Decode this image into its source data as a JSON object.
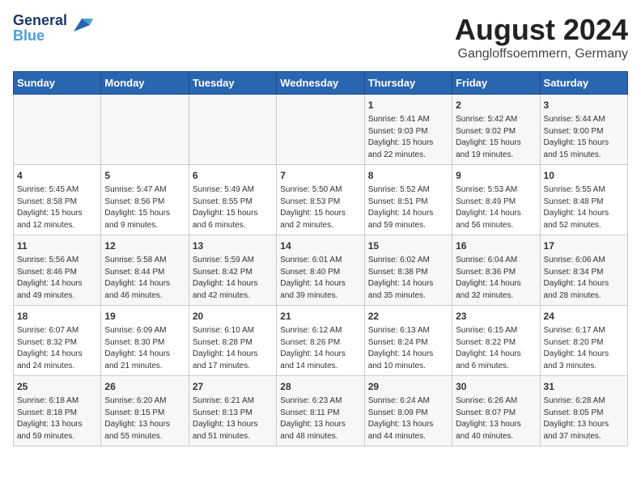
{
  "header": {
    "logo_line1": "General",
    "logo_line2": "Blue",
    "main_title": "August 2024",
    "subtitle": "Gangloffsoemmern, Germany"
  },
  "days_of_week": [
    "Sunday",
    "Monday",
    "Tuesday",
    "Wednesday",
    "Thursday",
    "Friday",
    "Saturday"
  ],
  "weeks": [
    [
      {
        "day": "",
        "detail": ""
      },
      {
        "day": "",
        "detail": ""
      },
      {
        "day": "",
        "detail": ""
      },
      {
        "day": "",
        "detail": ""
      },
      {
        "day": "1",
        "detail": "Sunrise: 5:41 AM\nSunset: 9:03 PM\nDaylight: 15 hours\nand 22 minutes."
      },
      {
        "day": "2",
        "detail": "Sunrise: 5:42 AM\nSunset: 9:02 PM\nDaylight: 15 hours\nand 19 minutes."
      },
      {
        "day": "3",
        "detail": "Sunrise: 5:44 AM\nSunset: 9:00 PM\nDaylight: 15 hours\nand 15 minutes."
      }
    ],
    [
      {
        "day": "4",
        "detail": "Sunrise: 5:45 AM\nSunset: 8:58 PM\nDaylight: 15 hours\nand 12 minutes."
      },
      {
        "day": "5",
        "detail": "Sunrise: 5:47 AM\nSunset: 8:56 PM\nDaylight: 15 hours\nand 9 minutes."
      },
      {
        "day": "6",
        "detail": "Sunrise: 5:49 AM\nSunset: 8:55 PM\nDaylight: 15 hours\nand 6 minutes."
      },
      {
        "day": "7",
        "detail": "Sunrise: 5:50 AM\nSunset: 8:53 PM\nDaylight: 15 hours\nand 2 minutes."
      },
      {
        "day": "8",
        "detail": "Sunrise: 5:52 AM\nSunset: 8:51 PM\nDaylight: 14 hours\nand 59 minutes."
      },
      {
        "day": "9",
        "detail": "Sunrise: 5:53 AM\nSunset: 8:49 PM\nDaylight: 14 hours\nand 56 minutes."
      },
      {
        "day": "10",
        "detail": "Sunrise: 5:55 AM\nSunset: 8:48 PM\nDaylight: 14 hours\nand 52 minutes."
      }
    ],
    [
      {
        "day": "11",
        "detail": "Sunrise: 5:56 AM\nSunset: 8:46 PM\nDaylight: 14 hours\nand 49 minutes."
      },
      {
        "day": "12",
        "detail": "Sunrise: 5:58 AM\nSunset: 8:44 PM\nDaylight: 14 hours\nand 46 minutes."
      },
      {
        "day": "13",
        "detail": "Sunrise: 5:59 AM\nSunset: 8:42 PM\nDaylight: 14 hours\nand 42 minutes."
      },
      {
        "day": "14",
        "detail": "Sunrise: 6:01 AM\nSunset: 8:40 PM\nDaylight: 14 hours\nand 39 minutes."
      },
      {
        "day": "15",
        "detail": "Sunrise: 6:02 AM\nSunset: 8:38 PM\nDaylight: 14 hours\nand 35 minutes."
      },
      {
        "day": "16",
        "detail": "Sunrise: 6:04 AM\nSunset: 8:36 PM\nDaylight: 14 hours\nand 32 minutes."
      },
      {
        "day": "17",
        "detail": "Sunrise: 6:06 AM\nSunset: 8:34 PM\nDaylight: 14 hours\nand 28 minutes."
      }
    ],
    [
      {
        "day": "18",
        "detail": "Sunrise: 6:07 AM\nSunset: 8:32 PM\nDaylight: 14 hours\nand 24 minutes."
      },
      {
        "day": "19",
        "detail": "Sunrise: 6:09 AM\nSunset: 8:30 PM\nDaylight: 14 hours\nand 21 minutes."
      },
      {
        "day": "20",
        "detail": "Sunrise: 6:10 AM\nSunset: 8:28 PM\nDaylight: 14 hours\nand 17 minutes."
      },
      {
        "day": "21",
        "detail": "Sunrise: 6:12 AM\nSunset: 8:26 PM\nDaylight: 14 hours\nand 14 minutes."
      },
      {
        "day": "22",
        "detail": "Sunrise: 6:13 AM\nSunset: 8:24 PM\nDaylight: 14 hours\nand 10 minutes."
      },
      {
        "day": "23",
        "detail": "Sunrise: 6:15 AM\nSunset: 8:22 PM\nDaylight: 14 hours\nand 6 minutes."
      },
      {
        "day": "24",
        "detail": "Sunrise: 6:17 AM\nSunset: 8:20 PM\nDaylight: 14 hours\nand 3 minutes."
      }
    ],
    [
      {
        "day": "25",
        "detail": "Sunrise: 6:18 AM\nSunset: 8:18 PM\nDaylight: 13 hours\nand 59 minutes."
      },
      {
        "day": "26",
        "detail": "Sunrise: 6:20 AM\nSunset: 8:15 PM\nDaylight: 13 hours\nand 55 minutes."
      },
      {
        "day": "27",
        "detail": "Sunrise: 6:21 AM\nSunset: 8:13 PM\nDaylight: 13 hours\nand 51 minutes."
      },
      {
        "day": "28",
        "detail": "Sunrise: 6:23 AM\nSunset: 8:11 PM\nDaylight: 13 hours\nand 48 minutes."
      },
      {
        "day": "29",
        "detail": "Sunrise: 6:24 AM\nSunset: 8:09 PM\nDaylight: 13 hours\nand 44 minutes."
      },
      {
        "day": "30",
        "detail": "Sunrise: 6:26 AM\nSunset: 8:07 PM\nDaylight: 13 hours\nand 40 minutes."
      },
      {
        "day": "31",
        "detail": "Sunrise: 6:28 AM\nSunset: 8:05 PM\nDaylight: 13 hours\nand 37 minutes."
      }
    ]
  ]
}
